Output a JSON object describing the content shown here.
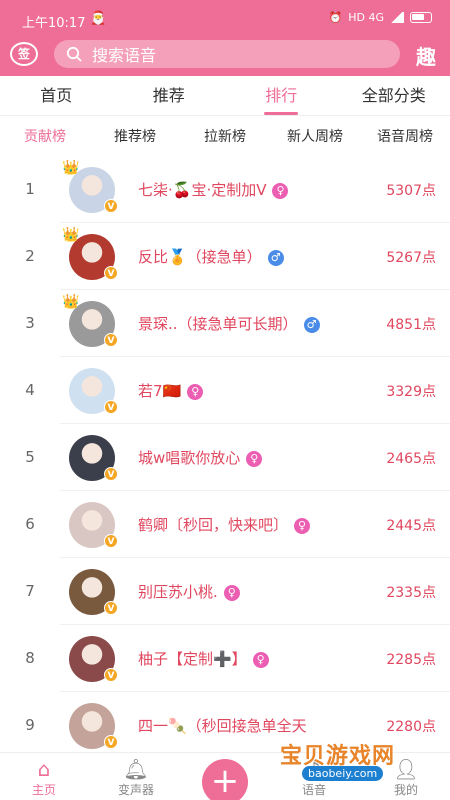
{
  "status": {
    "time": "上午10:17",
    "app_badge": "🎅",
    "network": "HD 4G"
  },
  "header": {
    "sign_label": "签",
    "search_placeholder": "搜索语音",
    "fun_label": "趣",
    "accent_color": "#EE6E97"
  },
  "nav": {
    "tabs": [
      {
        "label": "首页",
        "active": false
      },
      {
        "label": "推荐",
        "active": false
      },
      {
        "label": "排行",
        "active": true
      },
      {
        "label": "全部分类",
        "active": false
      }
    ]
  },
  "subnav": {
    "tabs": [
      {
        "label": "贡献榜",
        "active": true
      },
      {
        "label": "推荐榜",
        "active": false
      },
      {
        "label": "拉新榜",
        "active": false
      },
      {
        "label": "新人周榜",
        "active": false
      },
      {
        "label": "语音周榜",
        "active": false
      }
    ]
  },
  "ranking": [
    {
      "rank": "1",
      "name": "七柒·🍒宝·定制加V",
      "gender": "female",
      "gender_symbol": "♀",
      "points": "5307点",
      "crown": "👑"
    },
    {
      "rank": "2",
      "name": "反比🏅（接急单）",
      "gender": "male",
      "gender_symbol": "♂",
      "points": "5267点",
      "crown": "👑"
    },
    {
      "rank": "3",
      "name": "景琛..（接急单可长期）",
      "gender": "male",
      "gender_symbol": "♂",
      "points": "4851点",
      "crown": "👑"
    },
    {
      "rank": "4",
      "name": "若7🇨🇳",
      "gender": "female",
      "gender_symbol": "♀",
      "points": "3329点",
      "crown": ""
    },
    {
      "rank": "5",
      "name": "城w唱歌你放心",
      "gender": "female",
      "gender_symbol": "♀",
      "points": "2465点",
      "crown": ""
    },
    {
      "rank": "6",
      "name": "鹤卿〔秒回，快来吧〕",
      "gender": "female",
      "gender_symbol": "♀",
      "points": "2445点",
      "crown": ""
    },
    {
      "rank": "7",
      "name": "别压苏小桃.",
      "gender": "female",
      "gender_symbol": "♀",
      "points": "2335点",
      "crown": ""
    },
    {
      "rank": "8",
      "name": "柚子【定制➕】",
      "gender": "female",
      "gender_symbol": "♀",
      "points": "2285点",
      "crown": ""
    },
    {
      "rank": "9",
      "name": "四一🍡（秒回接急单全天",
      "gender": "female",
      "gender_symbol": "",
      "points": "2280点",
      "crown": ""
    }
  ],
  "avatar_colors": [
    "#c9d4e6",
    "#b33a2f",
    "#9a9a9a",
    "#cfe0f0",
    "#3b3f4c",
    "#d8c7c2",
    "#7a5a3f",
    "#8a4a4a",
    "#c4a49a"
  ],
  "tabbar": {
    "home": "主页",
    "voice_changer": "变声器",
    "add": "+",
    "voice_pack": "语音",
    "mine": "我的"
  },
  "watermark": {
    "title": "宝贝游戏网",
    "url": "baobeiy.com"
  }
}
